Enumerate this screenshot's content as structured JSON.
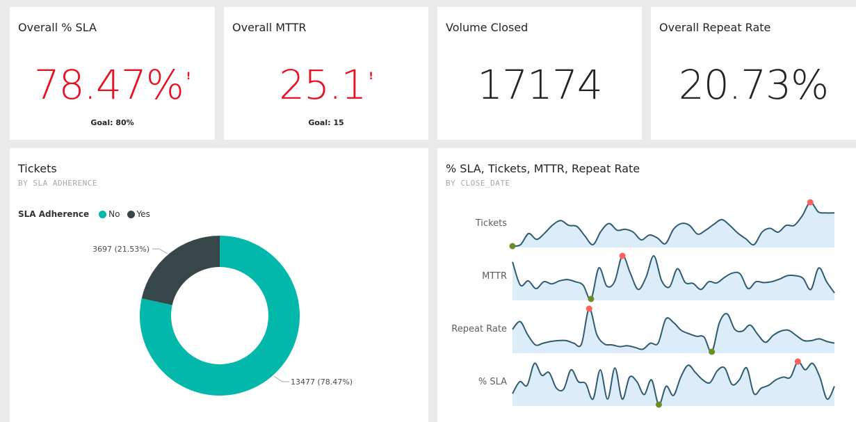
{
  "kpis": {
    "sla": {
      "title": "Overall % SLA",
      "value": "78.47%",
      "goal": "Goal: 80%",
      "alert": "!"
    },
    "mttr": {
      "title": "Overall MTTR",
      "value": "25.1",
      "goal": "Goal: 15",
      "alert": "!"
    },
    "volume": {
      "title": "Volume Closed",
      "value": "17174"
    },
    "repeat": {
      "title": "Overall Repeat Rate",
      "value": "20.73%"
    }
  },
  "colors": {
    "alert_red": "#e81123",
    "donut_no": "#01b8aa",
    "donut_yes": "#374649",
    "spark_line": "#2f5b70",
    "spark_fill": "#dcecf8",
    "spark_max": "#fd625e",
    "spark_min": "#6b8e23"
  },
  "chart_data": [
    {
      "type": "pie",
      "title": "Tickets",
      "subtitle": "BY SLA ADHERENCE",
      "legend_title": "SLA Adherence",
      "legend_placement": "top-left",
      "donut": true,
      "slices": [
        {
          "name": "No",
          "value": 13477,
          "label": "13477 (78.47%)"
        },
        {
          "name": "Yes",
          "value": 3697,
          "label": "3697 (21.53%)"
        }
      ]
    },
    {
      "type": "line",
      "title": "% SLA, Tickets, MTTR, Repeat Rate",
      "subtitle": "BY CLOSE_DATE",
      "series": [
        {
          "name": "Tickets",
          "values": [
            1,
            4,
            27,
            15,
            28,
            45,
            54,
            44,
            42,
            22,
            4,
            32,
            48,
            34,
            36,
            30,
            14,
            24,
            18,
            6,
            36,
            48,
            44,
            26,
            34,
            46,
            56,
            44,
            28,
            16,
            4,
            30,
            38,
            30,
            44,
            44,
            64,
            92,
            72,
            70,
            70
          ]
        },
        {
          "name": "MTTR",
          "values": [
            86,
            32,
            42,
            24,
            40,
            35,
            42,
            45,
            40,
            32,
            0,
            72,
            30,
            40,
            100,
            60,
            22,
            50,
            100,
            42,
            28,
            70,
            38,
            36,
            22,
            40,
            37,
            50,
            60,
            58,
            24,
            40,
            38,
            40,
            46,
            54,
            54,
            48,
            22,
            72,
            40,
            14
          ]
        },
        {
          "name": "Repeat Rate",
          "values": [
            52,
            70,
            39,
            16,
            20,
            24,
            26,
            26,
            20,
            18,
            100,
            40,
            18,
            16,
            12,
            14,
            10,
            6,
            20,
            20,
            76,
            68,
            50,
            42,
            36,
            34,
            0,
            68,
            88,
            52,
            48,
            62,
            40,
            22,
            38,
            48,
            50,
            38,
            26,
            26,
            30,
            24,
            20
          ]
        },
        {
          "name": "% SLA",
          "values": [
            24,
            50,
            42,
            90,
            64,
            70,
            36,
            34,
            76,
            50,
            46,
            12,
            76,
            12,
            80,
            12,
            60,
            50,
            22,
            54,
            0,
            40,
            20,
            60,
            86,
            70,
            54,
            48,
            74,
            80,
            44,
            54,
            80,
            24,
            36,
            42,
            54,
            60,
            60,
            94,
            76,
            90,
            60,
            12,
            40
          ]
        }
      ]
    }
  ]
}
